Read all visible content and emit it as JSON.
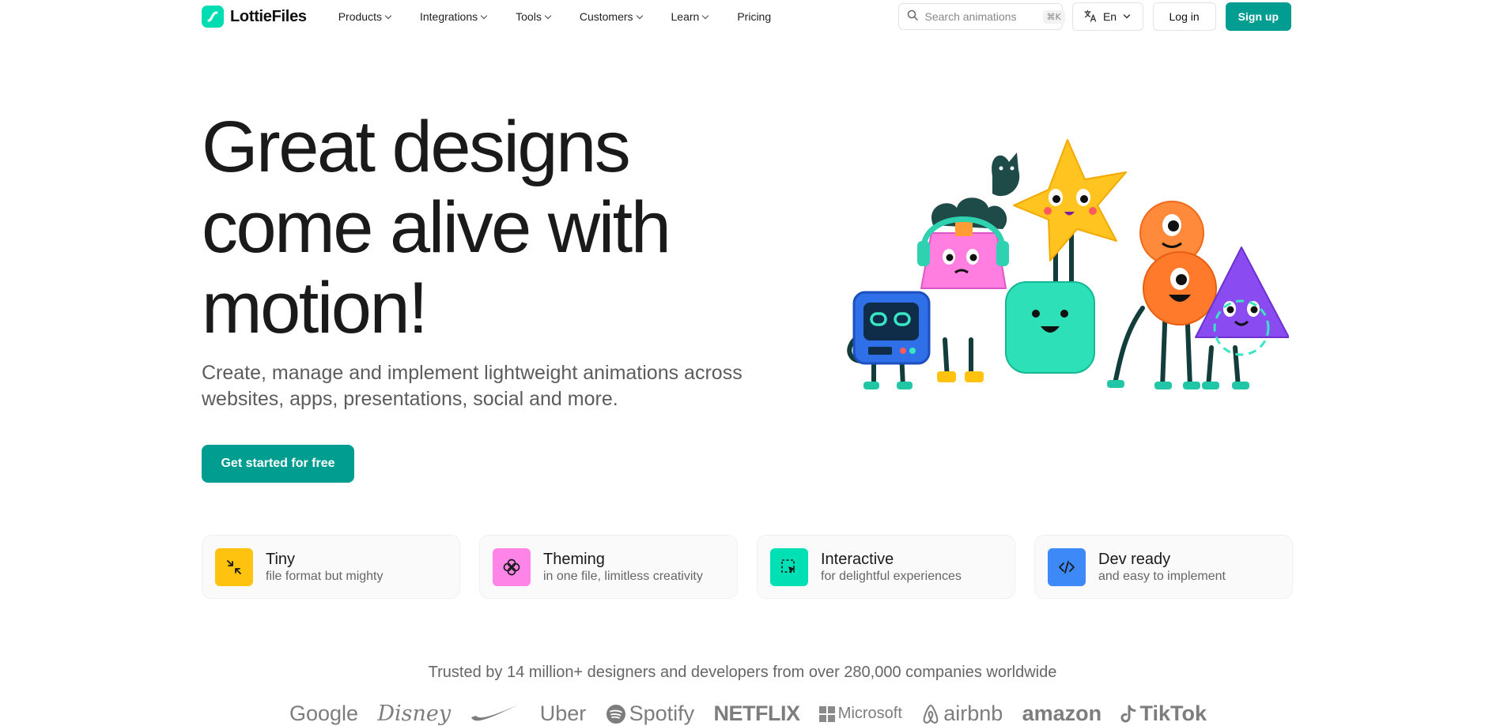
{
  "brand": {
    "name": "LottieFiles",
    "accent": "#019d91",
    "logo_color": "#00ddb3"
  },
  "nav": {
    "items": [
      {
        "label": "Products",
        "has_dropdown": true
      },
      {
        "label": "Integrations",
        "has_dropdown": true
      },
      {
        "label": "Tools",
        "has_dropdown": true
      },
      {
        "label": "Customers",
        "has_dropdown": true
      },
      {
        "label": "Learn",
        "has_dropdown": true
      },
      {
        "label": "Pricing",
        "has_dropdown": false
      }
    ],
    "search": {
      "placeholder": "Search animations",
      "shortcut": "⌘K",
      "icon": "search-icon"
    },
    "language": {
      "label": "En",
      "icon": "translate-icon"
    },
    "login_label": "Log in",
    "signup_label": "Sign up"
  },
  "hero": {
    "title_lines": [
      "Great designs",
      "come alive with",
      "motion!"
    ],
    "subtitle_lines": [
      "Create, manage and implement lightweight animations across",
      "websites, apps, presentations, social and more."
    ],
    "cta_label": "Get started for free"
  },
  "features": [
    {
      "title": "Tiny",
      "desc": "file format but mighty",
      "icon": "compress-icon",
      "color": "#ffc20e"
    },
    {
      "title": "Theming",
      "desc": "in one file, limitless creativity",
      "icon": "theming-icon",
      "color": "#ff84e8"
    },
    {
      "title": "Interactive",
      "desc": "for delightful experiences",
      "icon": "cursor-select-icon",
      "color": "#00e0b4"
    },
    {
      "title": "Dev ready",
      "desc": "and easy to implement",
      "icon": "code-icon",
      "color": "#3c89f7"
    }
  ],
  "trusted": {
    "text": "Trusted by 14 million+ designers and developers from over 280,000 companies worldwide",
    "logos": [
      "Google",
      "Disney",
      "Nike",
      "Uber",
      "Spotify",
      "NETFLIX",
      "Microsoft",
      "airbnb",
      "amazon",
      "TikTok"
    ]
  }
}
